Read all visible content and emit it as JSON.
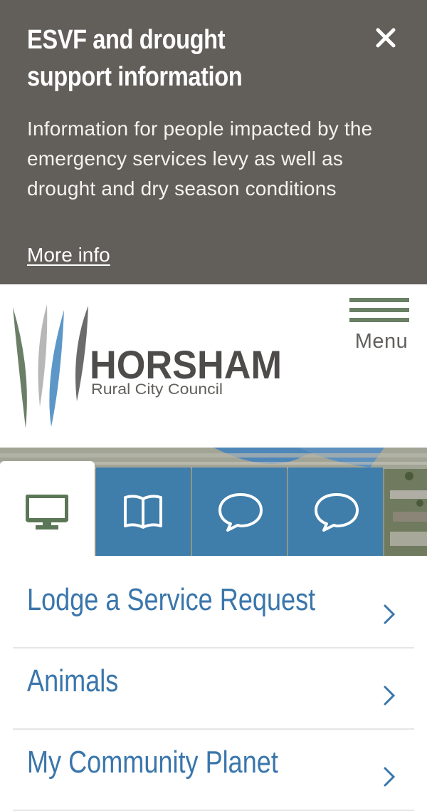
{
  "alert": {
    "title": "ESVF and drought support information",
    "body": "Information for people impacted by the emergency services levy as well as drought and dry season conditions",
    "link_label": "More info"
  },
  "header": {
    "logo_name": "HORSHAM",
    "logo_sub": "Rural City Council",
    "menu_label": "Menu"
  },
  "tabs": [
    {
      "icon": "monitor-icon",
      "active": true
    },
    {
      "icon": "book-icon",
      "active": false
    },
    {
      "icon": "speech-bubble-icon",
      "active": false
    },
    {
      "icon": "speech-bubble-icon",
      "active": false
    }
  ],
  "quick_links": [
    {
      "label": "Lodge a Service Request"
    },
    {
      "label": "Animals"
    },
    {
      "label": "My Community Planet"
    }
  ],
  "colors": {
    "alert_bg": "#625e59",
    "brand_blue": "#3f7daa",
    "link_blue": "#3a76ab",
    "brand_green": "#6a8064"
  }
}
